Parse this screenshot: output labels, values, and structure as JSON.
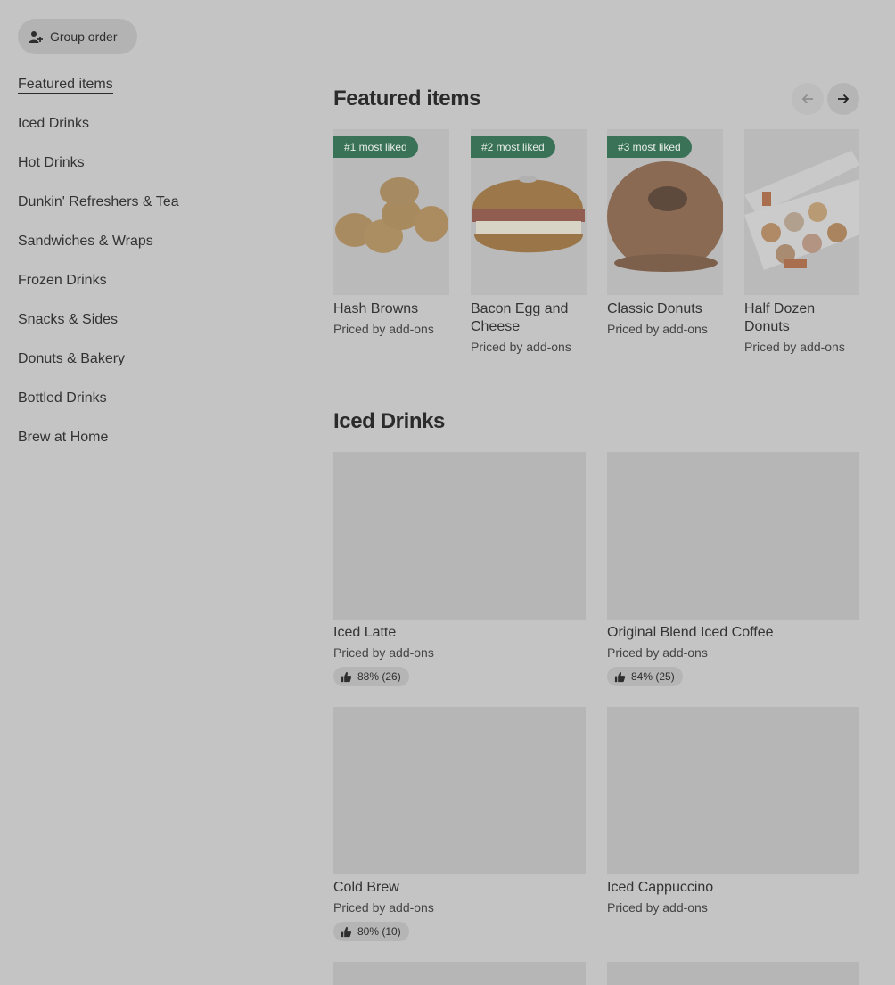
{
  "header": {
    "group_order_label": "Group order"
  },
  "sidebar": {
    "items": [
      {
        "label": "Featured items",
        "active": true
      },
      {
        "label": "Iced Drinks"
      },
      {
        "label": "Hot Drinks"
      },
      {
        "label": "Dunkin' Refreshers & Tea"
      },
      {
        "label": "Sandwiches & Wraps"
      },
      {
        "label": "Frozen Drinks"
      },
      {
        "label": "Snacks & Sides"
      },
      {
        "label": "Donuts & Bakery"
      },
      {
        "label": "Bottled Drinks"
      },
      {
        "label": "Brew at Home"
      }
    ]
  },
  "featured": {
    "title": "Featured items",
    "items": [
      {
        "badge": "#1 most liked",
        "name": "Hash Browns",
        "price": "Priced by add-ons"
      },
      {
        "badge": "#2 most liked",
        "name": "Bacon Egg and Cheese",
        "price": "Priced by add-ons"
      },
      {
        "badge": "#3 most liked",
        "name": "Classic Donuts",
        "price": "Priced by add-ons"
      },
      {
        "name": "Half Dozen Donuts",
        "price": "Priced by add-ons"
      }
    ]
  },
  "iced": {
    "title": "Iced Drinks",
    "items": [
      {
        "name": "Iced Latte",
        "price": "Priced by add-ons",
        "rating": "88% (26)"
      },
      {
        "name": "Original Blend Iced Coffee",
        "price": "Priced by add-ons",
        "rating": "84% (25)"
      },
      {
        "name": "Cold Brew",
        "price": "Priced by add-ons",
        "rating": "80% (10)"
      },
      {
        "name": "Iced Cappuccino",
        "price": "Priced by add-ons"
      }
    ]
  },
  "colors": {
    "badge_green": "#3a7257",
    "overlay_gray": "#c4c4c4"
  }
}
